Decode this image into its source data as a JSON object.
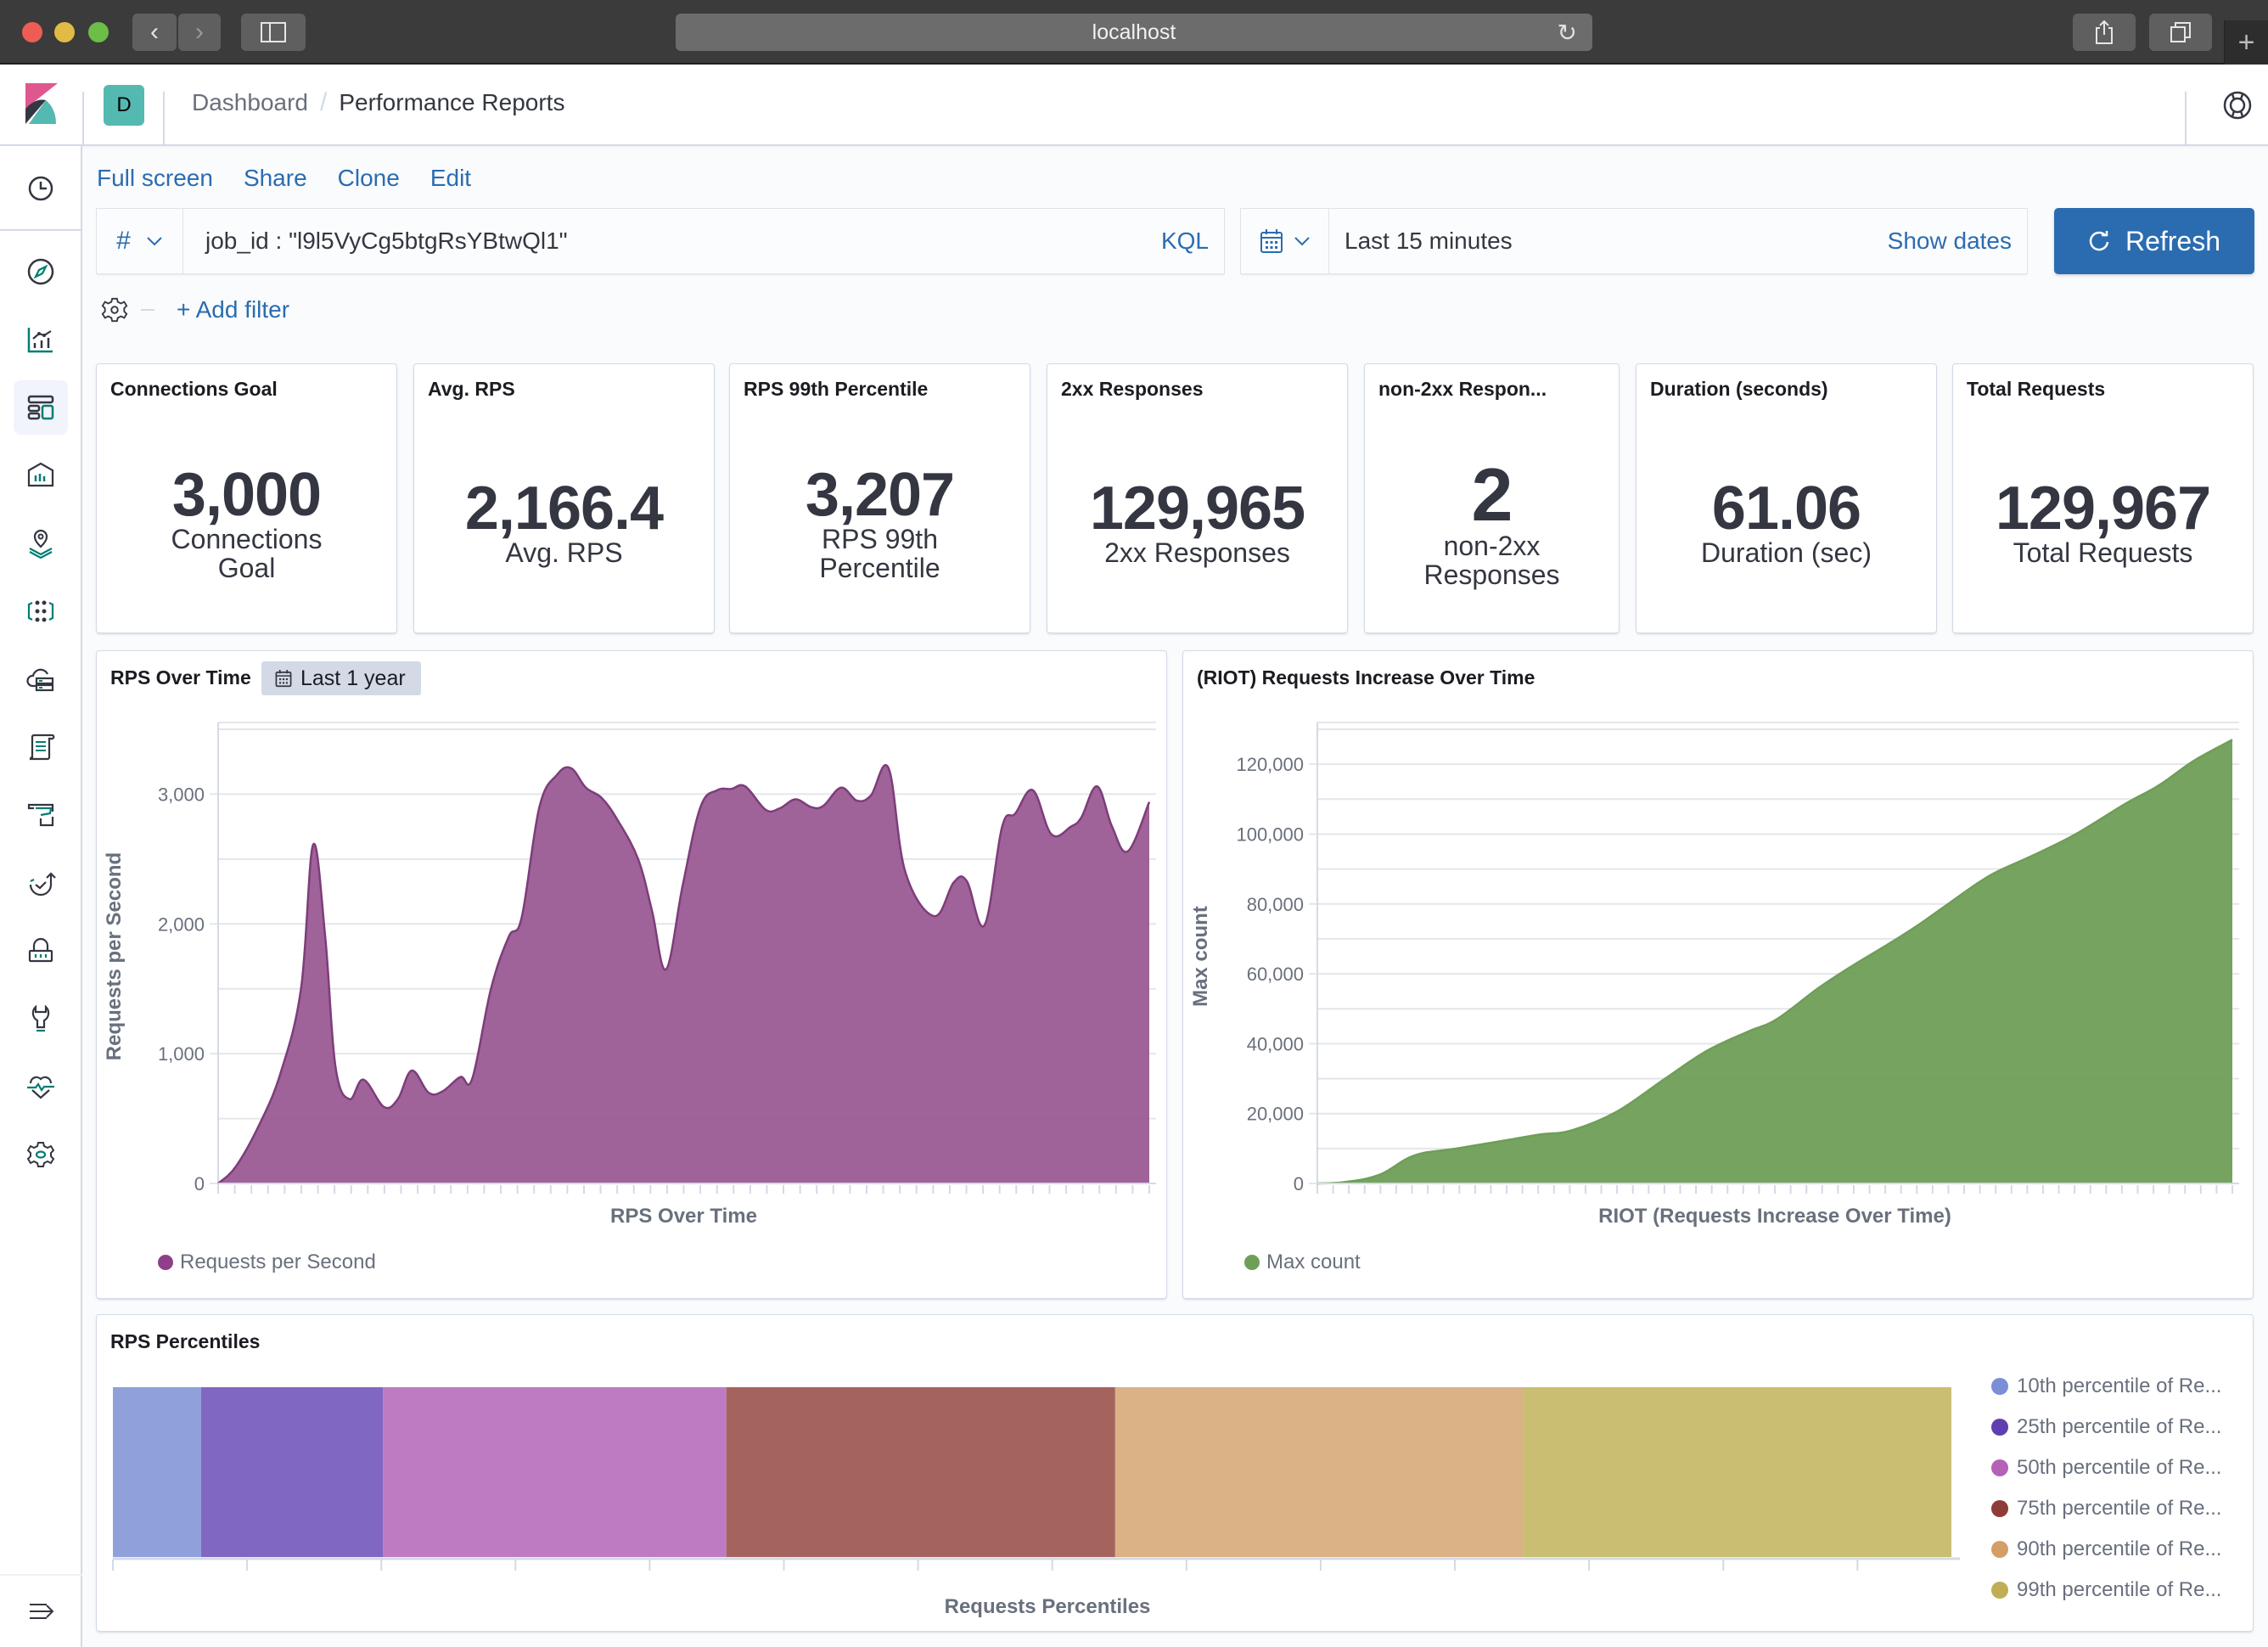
{
  "browser": {
    "url": "localhost"
  },
  "header": {
    "space_initial": "D",
    "breadcrumbs": [
      "Dashboard",
      "Performance Reports"
    ],
    "separator": "/"
  },
  "sidebar": {
    "items": [
      {
        "name": "recently-viewed",
        "icon": "clock-icon"
      },
      {
        "name": "discover",
        "icon": "compass-icon"
      },
      {
        "name": "visualize",
        "icon": "visualize-icon"
      },
      {
        "name": "dashboard",
        "icon": "dashboard-icon",
        "active": true
      },
      {
        "name": "canvas",
        "icon": "canvas-icon"
      },
      {
        "name": "maps",
        "icon": "maps-icon"
      },
      {
        "name": "machine-learning",
        "icon": "ml-icon"
      },
      {
        "name": "infrastructure",
        "icon": "infrastructure-icon"
      },
      {
        "name": "logs",
        "icon": "logs-icon"
      },
      {
        "name": "apm",
        "icon": "apm-icon"
      },
      {
        "name": "uptime",
        "icon": "uptime-icon"
      },
      {
        "name": "siem",
        "icon": "siem-icon"
      },
      {
        "name": "dev-tools",
        "icon": "wrench-icon"
      },
      {
        "name": "stack-monitoring",
        "icon": "heartbeat-icon"
      },
      {
        "name": "management",
        "icon": "gear-icon"
      }
    ],
    "collapse_icon": "menu-collapse-icon"
  },
  "topnav": {
    "full_screen": "Full screen",
    "share": "Share",
    "clone": "Clone",
    "edit": "Edit"
  },
  "query": {
    "language_icon": "#",
    "value": "job_id : \"l9l5VyCg5btgRsYBtwQl1\"",
    "language": "KQL"
  },
  "datepicker": {
    "value": "Last 15 minutes",
    "show_dates": "Show dates",
    "refresh": "Refresh"
  },
  "filters": {
    "add_filter": "+ Add filter"
  },
  "metrics": [
    {
      "title": "Connections Goal",
      "value": "3,000",
      "label": [
        "Connections",
        "Goal"
      ]
    },
    {
      "title": "Avg. RPS",
      "value": "2,166.4",
      "label": [
        "Avg. RPS"
      ]
    },
    {
      "title": "RPS 99th Percentile",
      "value": "3,207",
      "label": [
        "RPS 99th",
        "Percentile"
      ]
    },
    {
      "title": "2xx Responses",
      "value": "129,965",
      "label": [
        "2xx Responses"
      ]
    },
    {
      "title": "non-2xx Respon...",
      "value": "2",
      "label": [
        "non-2xx",
        "Responses"
      ]
    },
    {
      "title": "Duration (seconds)",
      "value": "61.06",
      "label": [
        "Duration (sec)"
      ]
    },
    {
      "title": "Total Requests",
      "value": "129,967",
      "label": [
        "Total Requests"
      ]
    }
  ],
  "panels": {
    "rps": {
      "title": "RPS Over Time",
      "time_badge": "Last 1 year"
    },
    "riot": {
      "title": "(RIOT) Requests Increase Over Time"
    },
    "percentiles": {
      "title": "RPS Percentiles"
    }
  },
  "chart_data": [
    {
      "type": "area",
      "title": "RPS Over Time",
      "xlabel": "RPS Over Time",
      "ylabel": "Requests per Second",
      "ylim": [
        0,
        3500
      ],
      "yticks": [
        0,
        1000,
        2000,
        3000
      ],
      "ytick_labels": [
        "0",
        "1,000",
        "2,000",
        "3,000"
      ],
      "grid": true,
      "legend": "bottom-left",
      "series": [
        {
          "name": "Requests per Second",
          "color": "#9a5b94",
          "x": [
            0,
            0.019,
            0.044,
            0.067,
            0.089,
            0.102,
            0.115,
            0.126,
            0.141,
            0.156,
            0.178,
            0.193,
            0.208,
            0.226,
            0.241,
            0.26,
            0.273,
            0.293,
            0.312,
            0.326,
            0.345,
            0.364,
            0.379,
            0.395,
            0.412,
            0.429,
            0.451,
            0.466,
            0.481,
            0.499,
            0.518,
            0.536,
            0.551,
            0.566,
            0.588,
            0.603,
            0.62,
            0.637,
            0.65,
            0.669,
            0.686,
            0.701,
            0.72,
            0.738,
            0.769,
            0.79,
            0.804,
            0.823,
            0.842,
            0.856,
            0.875,
            0.895,
            0.916,
            0.927,
            0.944,
            0.96,
            0.977,
            1.0
          ],
          "values": [
            0,
            130,
            450,
            850,
            1500,
            2610,
            1900,
            900,
            650,
            800,
            590,
            650,
            870,
            700,
            710,
            820,
            810,
            1500,
            1900,
            2050,
            2900,
            3150,
            3200,
            3050,
            2970,
            2800,
            2500,
            2100,
            1650,
            2300,
            2900,
            3030,
            3040,
            3060,
            2880,
            2890,
            2960,
            2900,
            2910,
            3050,
            2950,
            2990,
            3200,
            2400,
            2060,
            2320,
            2330,
            1990,
            2750,
            2850,
            3030,
            2690,
            2750,
            2820,
            3060,
            2750,
            2560,
            2940
          ]
        }
      ]
    },
    {
      "type": "area",
      "title": "(RIOT) Requests Increase Over Time",
      "xlabel": "RIOT (Requests Increase Over Time)",
      "ylabel": "Max count",
      "ylim": [
        0,
        130000
      ],
      "yticks": [
        0,
        20000,
        40000,
        60000,
        80000,
        100000,
        120000
      ],
      "ytick_labels": [
        "0",
        "20,000",
        "40,000",
        "60,000",
        "80,000",
        "100,000",
        "120,000"
      ],
      "grid": true,
      "legend": "bottom-left",
      "series": [
        {
          "name": "Max count",
          "color": "#6f9e57",
          "x": [
            0,
            0.03,
            0.068,
            0.106,
            0.152,
            0.198,
            0.243,
            0.278,
            0.327,
            0.38,
            0.426,
            0.471,
            0.502,
            0.548,
            0.586,
            0.624,
            0.654,
            0.684,
            0.722,
            0.745,
            0.783,
            0.829,
            0.882,
            0.92,
            0.958,
            1.0
          ],
          "values": [
            0,
            400,
            2500,
            8000,
            10000,
            12000,
            14000,
            15200,
            20500,
            30000,
            38000,
            43500,
            47000,
            56000,
            62500,
            68500,
            73500,
            79000,
            86000,
            89500,
            94000,
            100000,
            108500,
            114000,
            121000,
            127000
          ]
        }
      ]
    },
    {
      "type": "bar",
      "orientation": "horizontal-stacked",
      "title": "RPS Percentiles",
      "xlabel": "Requests Percentiles",
      "ylabel": "",
      "legend": "right",
      "series": [
        {
          "name": "10th percentile of Re...",
          "value": 660,
          "color": "#7b8fd6",
          "bar_color": "#8fa0db"
        },
        {
          "name": "25th percentile of Re...",
          "value": 1360,
          "color": "#5e3fb0",
          "bar_color": "#8067c1"
        },
        {
          "name": "50th percentile of Re...",
          "value": 2570,
          "color": "#b461b8",
          "bar_color": "#be7bc2"
        },
        {
          "name": "75th percentile of Re...",
          "value": 2910,
          "color": "#8f3b37",
          "bar_color": "#a5635e"
        },
        {
          "name": "90th percentile of Re...",
          "value": 3050,
          "color": "#d49e66",
          "bar_color": "#dbb186"
        },
        {
          "name": "99th percentile of Re...",
          "value": 3207,
          "color": "#bfae55",
          "bar_color": "#cabe72"
        }
      ]
    }
  ]
}
